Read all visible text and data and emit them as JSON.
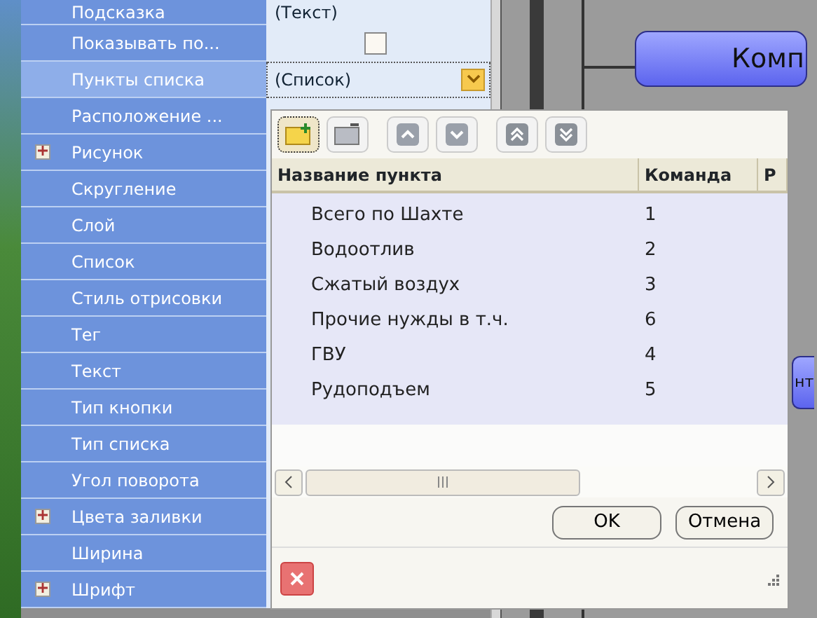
{
  "properties": [
    {
      "name": "Подсказка",
      "kind": "text",
      "value": "(Текст)",
      "expandable": false,
      "selected": false
    },
    {
      "name": "Показывать по...",
      "kind": "checkbox",
      "checked": false,
      "expandable": false,
      "selected": false
    },
    {
      "name": "Пункты списка",
      "kind": "dropdown",
      "value": "(Список)",
      "expandable": false,
      "selected": true
    },
    {
      "name": "Расположение ...",
      "kind": "covered",
      "expandable": false,
      "selected": false
    },
    {
      "name": "Рисунок",
      "kind": "covered",
      "expandable": true,
      "selected": false
    },
    {
      "name": "Скругление",
      "kind": "covered",
      "expandable": false,
      "selected": false
    },
    {
      "name": "Слой",
      "kind": "covered",
      "expandable": false,
      "selected": false
    },
    {
      "name": "Список",
      "kind": "covered",
      "expandable": false,
      "selected": false
    },
    {
      "name": "Стиль отрисовки",
      "kind": "covered",
      "expandable": false,
      "selected": false
    },
    {
      "name": "Тег",
      "kind": "covered",
      "expandable": false,
      "selected": false
    },
    {
      "name": "Текст",
      "kind": "covered",
      "expandable": false,
      "selected": false
    },
    {
      "name": "Тип кнопки",
      "kind": "covered",
      "expandable": false,
      "selected": false
    },
    {
      "name": "Тип списка",
      "kind": "covered",
      "expandable": false,
      "selected": false
    },
    {
      "name": "Угол поворота",
      "kind": "covered",
      "expandable": false,
      "selected": false
    },
    {
      "name": "Цвета заливки",
      "kind": "covered",
      "expandable": true,
      "selected": false
    },
    {
      "name": "Ширина",
      "kind": "covered",
      "expandable": false,
      "selected": false
    },
    {
      "name": "Шрифт",
      "kind": "covered",
      "expandable": true,
      "selected": false
    }
  ],
  "canvas_buttons": [
    "Комп",
    "нт"
  ],
  "editor": {
    "toolbar": [
      {
        "kind": "add"
      },
      {
        "kind": "remove"
      },
      {
        "kind": "up"
      },
      {
        "kind": "down"
      },
      {
        "kind": "top"
      },
      {
        "kind": "bottom"
      }
    ],
    "columns": [
      "Название пункта",
      "Команда",
      "Р"
    ],
    "rows": [
      {
        "name": "Всего по Шахте",
        "command": "1"
      },
      {
        "name": "Водоотлив",
        "command": "2"
      },
      {
        "name": "Сжатый воздух",
        "command": "3"
      },
      {
        "name": "Прочие нужды в т.ч.",
        "command": "6"
      },
      {
        "name": "ГВУ",
        "command": "4"
      },
      {
        "name": "Рудоподъем",
        "command": "5"
      }
    ],
    "buttons": [
      "OK",
      "Отмена"
    ]
  }
}
